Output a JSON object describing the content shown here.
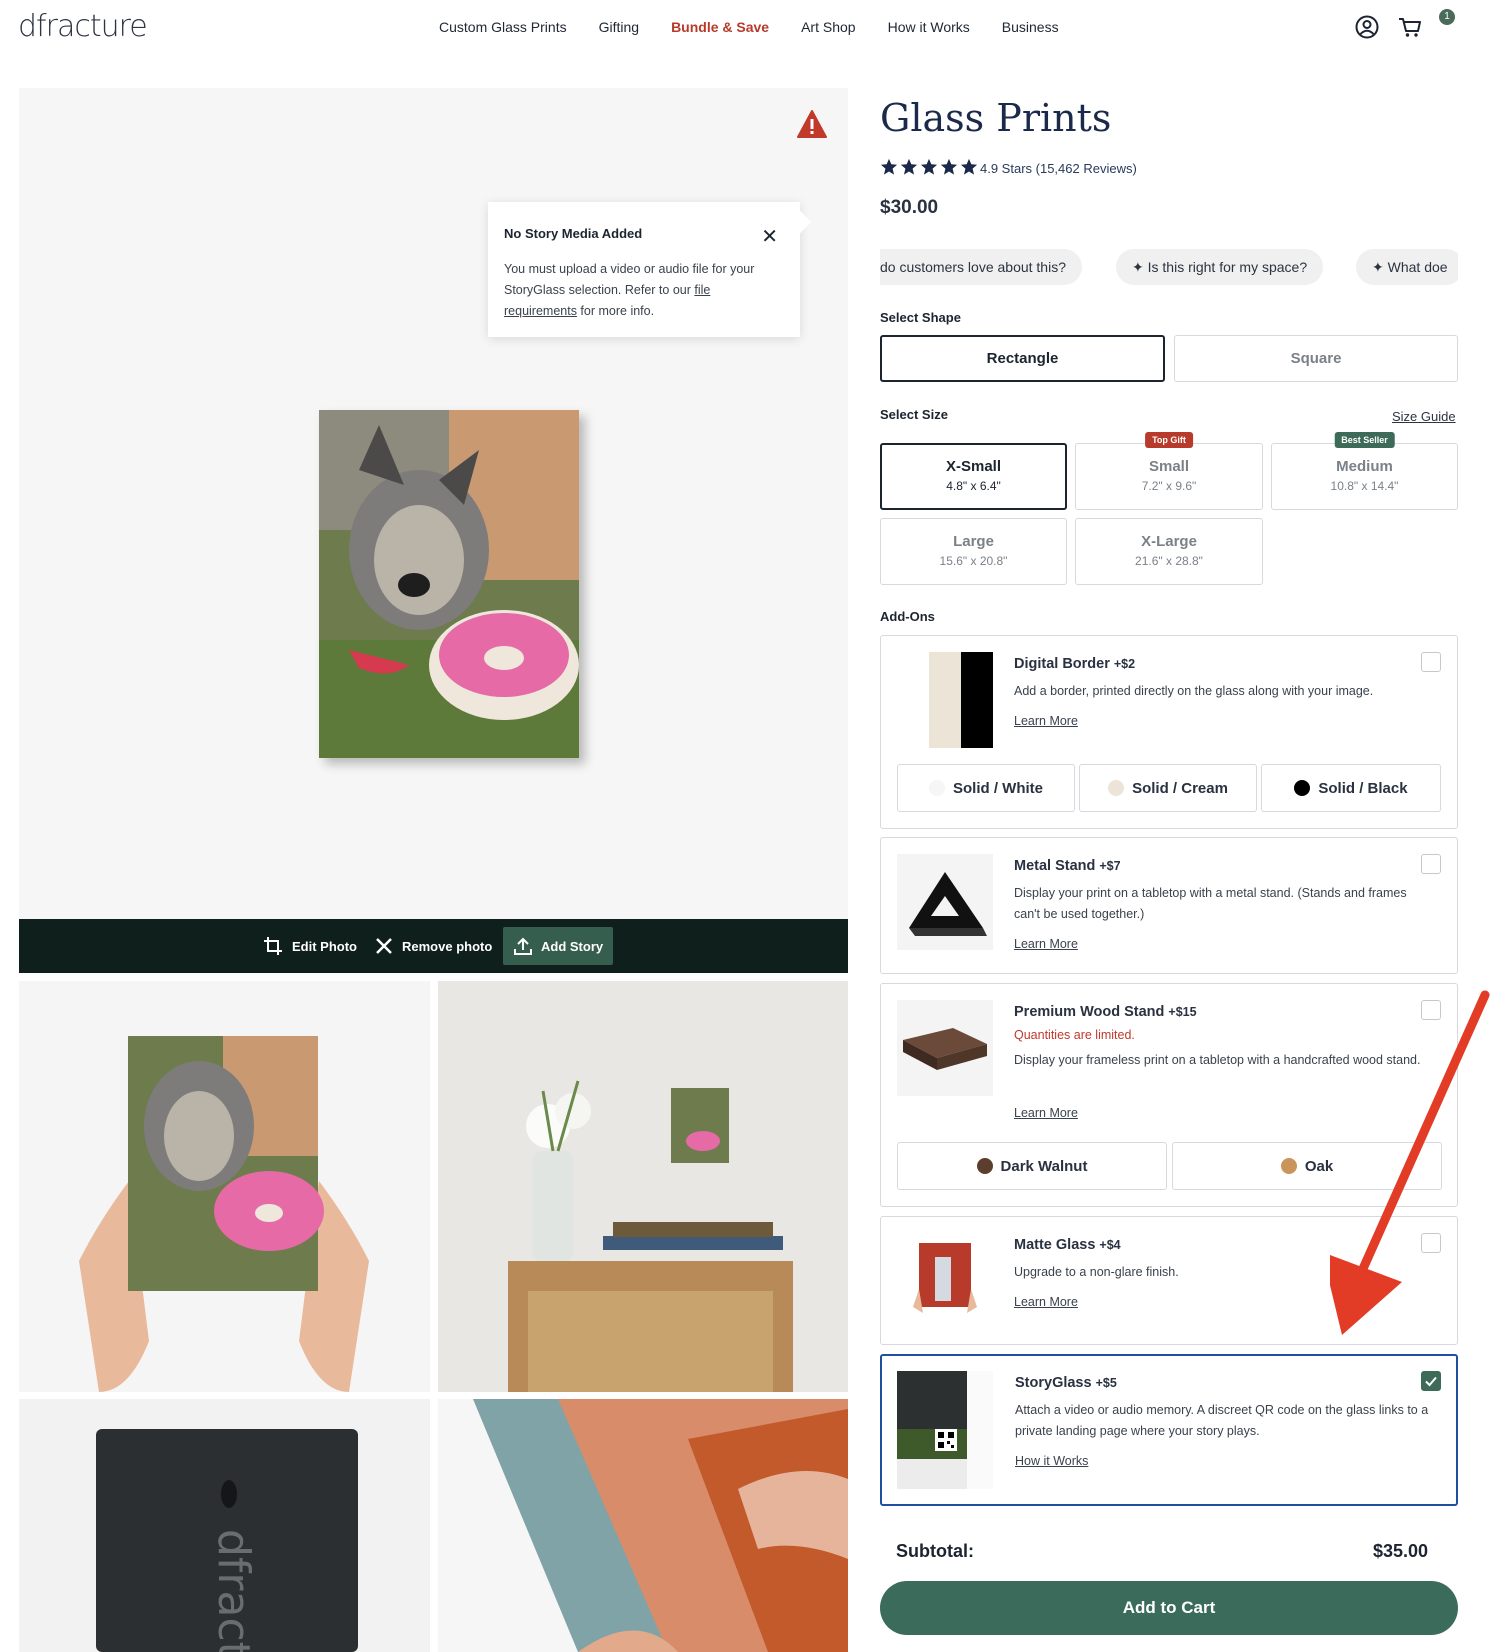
{
  "header": {
    "logo": "dfracture",
    "nav": [
      "Custom Glass Prints",
      "Gifting",
      "Bundle & Save",
      "Art Shop",
      "How it Works",
      "Business"
    ],
    "cart_count": "1",
    "accent_color": "#b83a2b"
  },
  "gallery": {
    "popover": {
      "title": "No Story Media Added",
      "body_pre": "You must upload a video or audio file for your StoryGlass selection. Refer to our ",
      "link": "file requirements",
      "body_post": " for more info."
    },
    "toolbar": {
      "edit": "Edit Photo",
      "remove": "Remove photo",
      "add_story": "Add Story"
    }
  },
  "product": {
    "title": "Glass Prints",
    "rating": "4.9 Stars (15,462 Reviews)",
    "stars": 5,
    "price": "$30.00",
    "chips": [
      "do customers love about this?",
      "Is this right for my space?",
      "What doe"
    ]
  },
  "shape": {
    "label": "Select Shape",
    "options": [
      "Rectangle",
      "Square"
    ],
    "selected": "Rectangle"
  },
  "size": {
    "label": "Select Size",
    "guide": "Size Guide",
    "options": [
      {
        "name": "X-Small",
        "dims": "4.8\" x 6.4\"",
        "tag": ""
      },
      {
        "name": "Small",
        "dims": "7.2\" x 9.6\"",
        "tag": "Top Gift"
      },
      {
        "name": "Medium",
        "dims": "10.8\" x 14.4\"",
        "tag": "Best Seller"
      },
      {
        "name": "Large",
        "dims": "15.6\" x 20.8\"",
        "tag": ""
      },
      {
        "name": "X-Large",
        "dims": "21.6\" x 28.8\"",
        "tag": ""
      }
    ],
    "selected": "X-Small"
  },
  "addons": {
    "label": "Add-Ons",
    "digital_border": {
      "title": "Digital Border",
      "price": "+$2",
      "desc": "Add a border, printed directly on the glass along with your image.",
      "link": "Learn More",
      "swatches": [
        "Solid / White",
        "Solid / Cream",
        "Solid / Black"
      ],
      "checked": false
    },
    "metal_stand": {
      "title": "Metal Stand",
      "price": "+$7",
      "desc": "Display your print on a tabletop with a metal stand. (Stands and frames can't be used together.)",
      "link": "Learn More",
      "checked": false
    },
    "wood_stand": {
      "title": "Premium Wood Stand",
      "price": "+$15",
      "warning": "Quantities are limited.",
      "desc": "Display your frameless print on a tabletop with a handcrafted wood stand.",
      "link": "Learn More",
      "swatches": [
        "Dark Walnut",
        "Oak"
      ],
      "checked": false
    },
    "matte": {
      "title": "Matte Glass",
      "price": "+$4",
      "desc": "Upgrade to a non-glare finish.",
      "link": "Learn More",
      "checked": false
    },
    "storyglass": {
      "title": "StoryGlass",
      "price": "+$5",
      "desc": "Attach a video or audio memory.  A discreet QR code on the glass links to a private landing page where your story plays.",
      "link": "How it Works",
      "checked": true
    }
  },
  "cart": {
    "subtotal_label": "Subtotal:",
    "subtotal": "$35.00",
    "add_to_cart": "Add to Cart",
    "button_color": "#3b6b5a"
  }
}
